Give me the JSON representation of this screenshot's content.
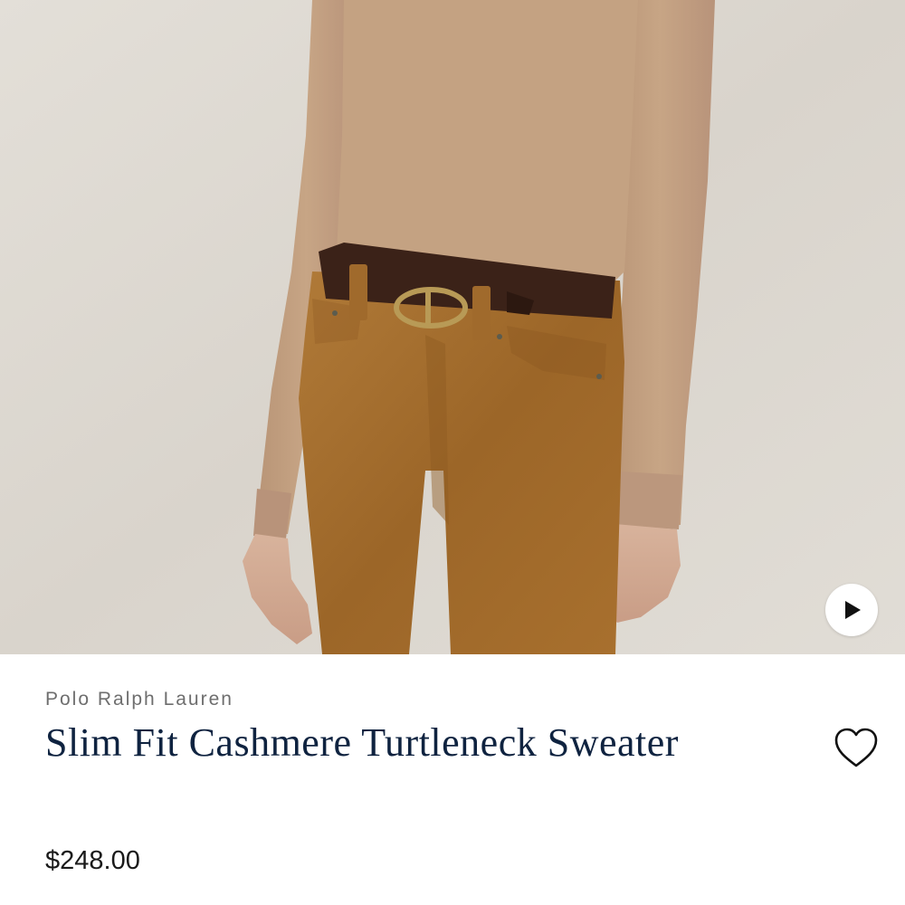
{
  "product": {
    "brand": "Polo Ralph Lauren",
    "title": "Slim Fit Cashmere Turtleneck Sweater",
    "price": "$248.00"
  },
  "media": {
    "play_icon": "play-icon",
    "wishlist_icon": "heart-outline-icon"
  },
  "colors": {
    "title_navy": "#0f2340",
    "brand_gray": "#6e6e6e",
    "sweater_camel": "#c39f7f",
    "suede_tan": "#a8702e",
    "belt_brown": "#3b2218",
    "backdrop": "#dedad3"
  }
}
